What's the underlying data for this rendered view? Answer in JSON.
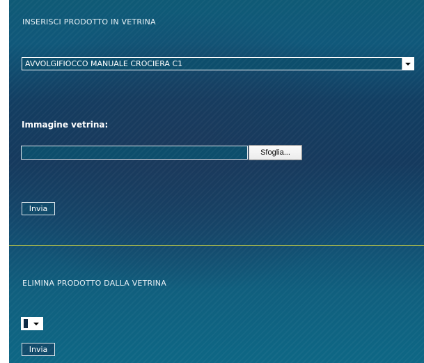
{
  "insert_section": {
    "heading": "INSERISCI PRODOTTO IN VETRINA",
    "product_select": {
      "selected": "AVVOLGIFIOCCO MANUALE CROCIERA C1"
    },
    "image_label": "Immagine vetrina:",
    "file_input": {
      "value": "",
      "browse_label": "Sfoglia..."
    },
    "submit_label": "Invia"
  },
  "delete_section": {
    "heading": "ELIMINA PRODOTTO DALLA VETRINA",
    "product_select": {
      "selected": ""
    },
    "submit_label": "Invia"
  },
  "colors": {
    "panel_background": "#123e62",
    "divider": "#a8b84a",
    "text": "#ffffff"
  }
}
